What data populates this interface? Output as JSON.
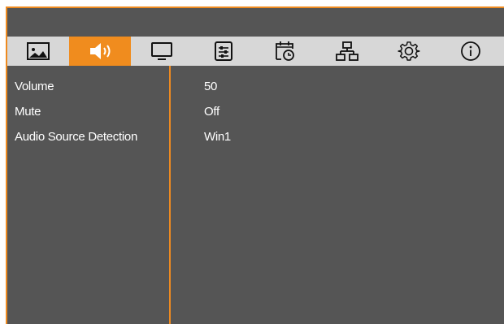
{
  "tabs": [
    {
      "icon": "picture-icon",
      "active": false
    },
    {
      "icon": "speaker-icon",
      "active": true
    },
    {
      "icon": "display-icon",
      "active": false
    },
    {
      "icon": "settings-sliders-icon",
      "active": false
    },
    {
      "icon": "schedule-icon",
      "active": false
    },
    {
      "icon": "network-icon",
      "active": false
    },
    {
      "icon": "gear-icon",
      "active": false
    },
    {
      "icon": "info-icon",
      "active": false
    }
  ],
  "menu": {
    "items": [
      {
        "label": "Volume",
        "value": "50"
      },
      {
        "label": "Mute",
        "value": "Off"
      },
      {
        "label": "Audio Source Detection",
        "value": "Win1"
      }
    ]
  },
  "colors": {
    "accent": "#f08c1e",
    "panel": "#555555",
    "tabbar": "#d7d7d7",
    "text": "#ffffff"
  }
}
